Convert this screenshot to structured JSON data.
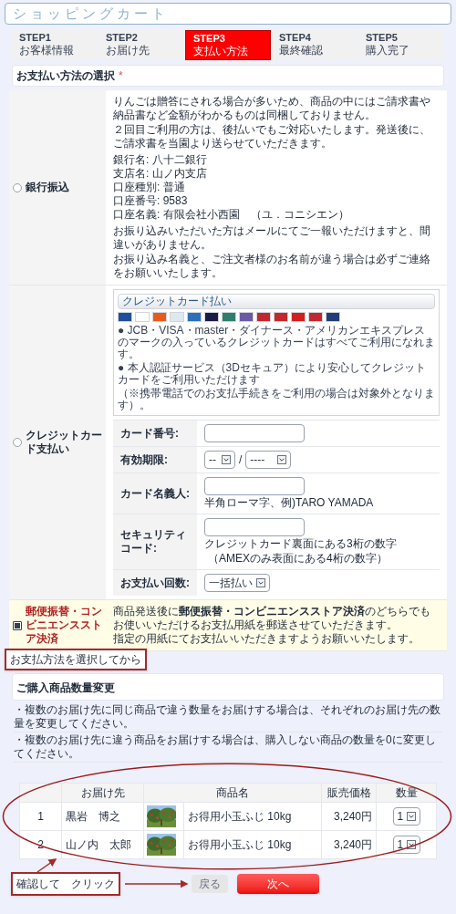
{
  "title": "ショッピングカート",
  "steps": [
    {
      "step": "STEP1",
      "label": "お客様情報",
      "selected": false
    },
    {
      "step": "STEP2",
      "label": "お届け先",
      "selected": false
    },
    {
      "step": "STEP3",
      "label": "支払い方法",
      "selected": true
    },
    {
      "step": "STEP4",
      "label": "最終確認",
      "selected": false
    },
    {
      "step": "STEP5",
      "label": "購入完了",
      "selected": false
    }
  ],
  "payment_section": {
    "title": "お支払い方法の選択",
    "required_mark": "*"
  },
  "payment_methods": [
    {
      "kind": "bank",
      "label": "銀行振込",
      "selected": false,
      "notes": [
        "りんごは贈答にされる場合が多いため、商品の中にはご請求書や納品書など金額がわかるものは同梱しておりません。",
        "２回目ご利用の方は、後払いでもご対応いたします。発送後に、ご請求書を当園より送らせていただきます。"
      ],
      "details": [
        "銀行名: 八十二銀行",
        "支店名: 山ノ内支店",
        "口座種別: 普通",
        "口座番号: 9583",
        "口座名義: 有限会社小西園　（ユ．コニシエン）"
      ],
      "footer": [
        "お振り込みいただいた方はメールにてご一報いただけますと、間違いがありません。",
        "お振り込み名義と、ご注文者様のお名前が違う場合は必ずご連絡をお願いいたします。"
      ]
    },
    {
      "kind": "card",
      "label": "クレジットカード支払い",
      "selected": false,
      "banner_title": "クレジットカード払い",
      "fine_print": [
        "● JCB・VISA・master・ダイナース・アメリカンエキスプレスのマークの入っているクレジットカードはすべてご利用になれます。",
        "● 本人認証サービス（3Dセキュア）により安心してクレジットカードをご利用いただけます",
        "（※携帯電話でのお支払手続きをご利用の場合は対象外となります）。"
      ],
      "fields": [
        {
          "kind": "text",
          "label": "カード番号:"
        },
        {
          "kind": "expiry",
          "label": "有効期限:",
          "month": "--",
          "separator": "/",
          "year": "----"
        },
        {
          "kind": "text",
          "label": "カード名義人:",
          "hints": [
            "半角ローマ字、例)TARO YAMADA"
          ]
        },
        {
          "kind": "text",
          "label": "セキュリティコード:",
          "hints": [
            "クレジットカード裏面にある3桁の数字",
            "（AMEXのみ表面にある4桁の数字）"
          ]
        },
        {
          "kind": "select",
          "label": "お支払い回数:",
          "value": "一括払い"
        }
      ]
    },
    {
      "kind": "postal",
      "label": "郵便振替・コンビニエンスストア決済",
      "selected": true,
      "description": [
        "商品発送後に**郵便振替・コンビニエンスストア決済**のどちらでもお使いいただけるお支払用紙を郵送させていただきます。",
        "指定の用紙にてお支払いいただきますようお願いいたします。"
      ]
    }
  ],
  "annotation_payment": "お支払方法を選択してから",
  "quantity_section": {
    "title": "ご購入商品数量変更",
    "notes": [
      "・複数のお届け先に同じ商品で違う数量をお届けする場合は、それぞれのお届け先の数量を変更してください。",
      "・複数のお届け先に違う商品をお届けする場合は、購入しない商品の数量を0に変更してください。"
    ]
  },
  "table": {
    "columns": [
      "お届け先",
      "商品名",
      "販売価格",
      "数量"
    ],
    "rows": [
      {
        "no": "1",
        "recipient": "黒岩　博之",
        "product": "お得用小玉ふじ 10kg",
        "price": "3,240円",
        "quantity": "1"
      },
      {
        "no": "2",
        "recipient": "山ノ内　太郎",
        "product": "お得用小玉ふじ 10kg",
        "price": "3,240円",
        "quantity": "1"
      }
    ]
  },
  "annotation_confirm": "確認して　クリック",
  "buttons": [
    {
      "kind": "back",
      "label": "戻る"
    },
    {
      "kind": "next",
      "label": "次へ"
    }
  ]
}
